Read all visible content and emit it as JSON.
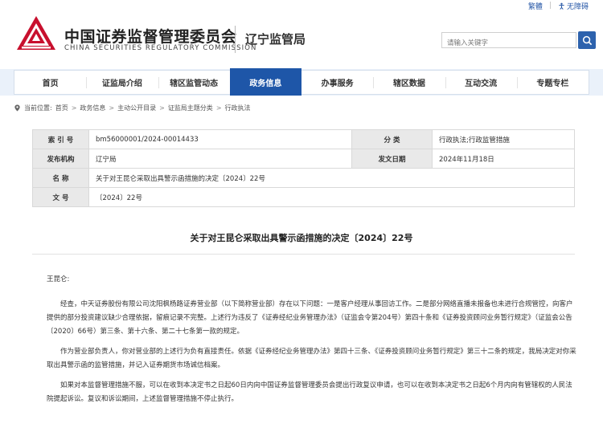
{
  "topbar": {
    "link_1": "繁體",
    "link_2": "无障碍",
    "access_icon": "accessibility-icon"
  },
  "header": {
    "org_cn": "中国证券监督管理委员会",
    "org_en": "CHINA SECURITIES REGULATORY COMMISSION",
    "region": "辽宁监管局",
    "logo_colors": {
      "red": "#c8102e",
      "white": "#ffffff"
    }
  },
  "search": {
    "placeholder": "请输入关键字",
    "button_icon": "search-icon"
  },
  "nav": {
    "items": [
      {
        "label": "首页"
      },
      {
        "label": "证监局介绍"
      },
      {
        "label": "辖区监管动态"
      },
      {
        "label": "政务信息"
      },
      {
        "label": "办事服务"
      },
      {
        "label": "辖区数据"
      },
      {
        "label": "互动交流"
      },
      {
        "label": "专题专栏"
      }
    ],
    "active_index": 3,
    "active_color": "#1e56a8"
  },
  "breadcrumb": {
    "prefix": "当前位置:",
    "items": [
      "首页",
      "政务信息",
      "主动公开目录",
      "证监局主题分类",
      "行政执法"
    ]
  },
  "info": {
    "index_label": "索 引 号",
    "index_value": "bm56000001/2024-00014433",
    "category_label": "分 类",
    "category_value": "行政执法;行政监管措施",
    "issuer_label": "发布机构",
    "issuer_value": "辽宁局",
    "date_label": "发文日期",
    "date_value": "2024年11月18日",
    "name_label": "名 称",
    "name_value": "关于对王昆仑采取出具警示函措施的决定〔2024〕22号",
    "docno_label": "文 号",
    "docno_value": "〔2024〕22号"
  },
  "document": {
    "title": "关于对王昆仑采取出具警示函措施的决定〔2024〕22号",
    "salutation": "王昆仑:",
    "paragraphs": [
      "经查，中天证券股份有限公司沈阳枫杨路证券营业部（以下简称营业部）存在以下问题：一是客户经理从事回访工作。二是部分网络直播未报备也未进行合规管控，向客户提供的部分投资建议缺少合理依据，留痕记录不完整。上述行为违反了《证券经纪业务管理办法》（证监会令第204号）第四十条和《证券投资顾问业务暂行规定》（证监会公告〔2020〕66号）第三条、第十六条、第二十七条第一款的规定。",
      "作为营业部负责人，你对营业部的上述行为负有直接责任。依据《证券经纪业务管理办法》第四十三条、《证券投资顾问业务暂行规定》第三十二条的规定，我局决定对你采取出具警示函的监管措施，并记入证券期货市场诚信档案。",
      "如果对本监督管理措施不服，可以在收到本决定书之日起60日内向中国证券监督管理委员会提出行政复议申请，也可以在收到本决定书之日起6个月内向有管辖权的人民法院提起诉讼。复议和诉讼期间，上述监督管理措施不停止执行。"
    ]
  }
}
